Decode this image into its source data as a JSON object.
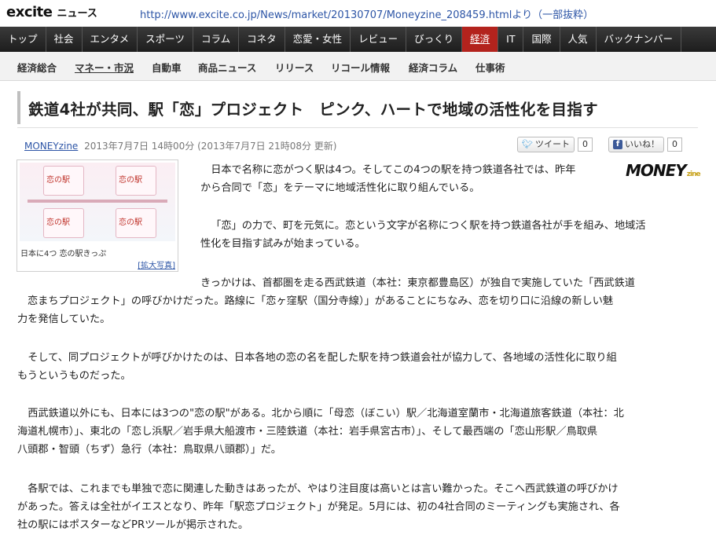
{
  "header": {
    "logo_brand": "excite",
    "logo_section": "ニュース",
    "source_text": "http://www.excite.co.jp/News/market/20130707/Moneyzine_208459.htmlより（一部抜粋）"
  },
  "main_nav": [
    "トップ",
    "社会",
    "エンタメ",
    "スポーツ",
    "コラム",
    "コネタ",
    "恋愛・女性",
    "レビュー",
    "びっくり",
    "経済",
    "IT",
    "国際",
    "人気",
    "バックナンバー"
  ],
  "main_nav_active": "経済",
  "sub_nav": [
    "経済総合",
    "マネー・市況",
    "自動車",
    "商品ニュース",
    "リリース",
    "リコール情報",
    "経済コラム",
    "仕事術"
  ],
  "sub_nav_current": "マネー・市況",
  "article": {
    "title": "鉄道4社が共同、駅「恋」プロジェクト　ピンク、ハートで地域の活性化を目指す",
    "publisher": "MONEYzine",
    "date": "2013年7月7日 14時00分 (2013年7月7日 21時08分 更新)",
    "tweet_label": "ツイート",
    "tweet_count": "0",
    "like_label": "いいね！",
    "like_count": "0",
    "photo_caption": "日本に4つ 恋の駅きっぷ",
    "photo_link": "[拡大写真]",
    "photo_ticket_label": "恋の駅",
    "money_logo": "MONEY",
    "money_logo_sub": "zine",
    "paragraphs": [
      [
        "日本で名称に恋がつく駅は4つ。そしてこの4つの駅を持つ鉄道各社では、昨年",
        "から合同で「恋」をテーマに地域活性化に取り組んでいる。"
      ],
      [
        "「恋」の力で、町を元気に。恋という文字が名称につく駅を持つ鉄道各社が手を組み、地域活",
        "性化を目指す試みが始まっている。"
      ],
      [
        "きっかけは、首都圏を走る西武鉄道（本社：東京都豊島区）が独自で実施していた「西武鉄道",
        "恋まちプロジェクト」の呼びかけだった。路線に「恋ヶ窪駅（国分寺線）」があることにちなみ、恋を切り口に沿線の新しい魅",
        "力を発信していた。"
      ],
      [
        "そして、同プロジェクトが呼びかけたのは、日本各地の恋の名を配した駅を持つ鉄道会社が協力して、各地域の活性化に取り組",
        "もうというものだった。"
      ],
      [
        "西武鉄道以外にも、日本には3つの\"恋の駅\"がある。北から順に「母恋（ぼこい）駅／北海道室蘭市・北海道旅客鉄道（本社：北",
        "海道札幌市）」、東北の「恋し浜駅／岩手県大船渡市・三陸鉄道（本社：岩手県宮古市）」、そして最西端の「恋山形駅／鳥取県",
        "八頭郡・智頭（ちず）急行（本社：鳥取県八頭郡）」だ。"
      ],
      [
        "各駅では、これまでも単独で恋に関連した動きはあったが、やはり注目度は高いとは言い難かった。そこへ西武鉄道の呼びかけ",
        "があった。答えは全社がイエスとなり、昨年「駅恋プロジェクト」が発足。5月には、初の4社合同のミーティングも実施され、各",
        "社の駅にはポスターなどPRツールが掲示された。"
      ]
    ]
  }
}
